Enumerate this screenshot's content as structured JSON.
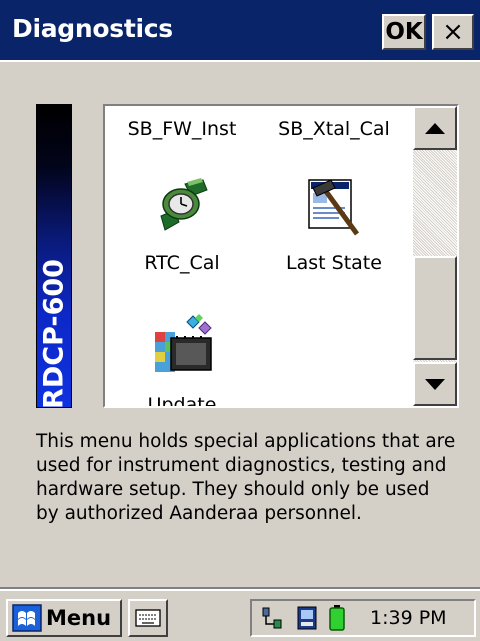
{
  "window": {
    "title": "Diagnostics",
    "ok_label": "OK",
    "close_label": "×"
  },
  "banner": {
    "text": "RDCP-600"
  },
  "list": {
    "items": [
      {
        "label": "SB_FW_Inst",
        "icon": "none"
      },
      {
        "label": "SB_Xtal_Cal",
        "icon": "none"
      },
      {
        "label": "RTC_Cal",
        "icon": "watch-icon"
      },
      {
        "label": "Last State",
        "icon": "hammer-document-icon"
      },
      {
        "label": "Update",
        "icon": "update-chip-icon"
      }
    ]
  },
  "description": "This menu holds special applications that are used for instrument diagnostics, testing and hardware setup. They should only be used by authorized Aanderaa personnel.",
  "taskbar": {
    "start_label": "Menu",
    "clock": "1:39 PM"
  },
  "colors": {
    "titlebar": "#0a246a",
    "face": "#d4d0c8",
    "banner_bottom": "#0f32e0"
  }
}
